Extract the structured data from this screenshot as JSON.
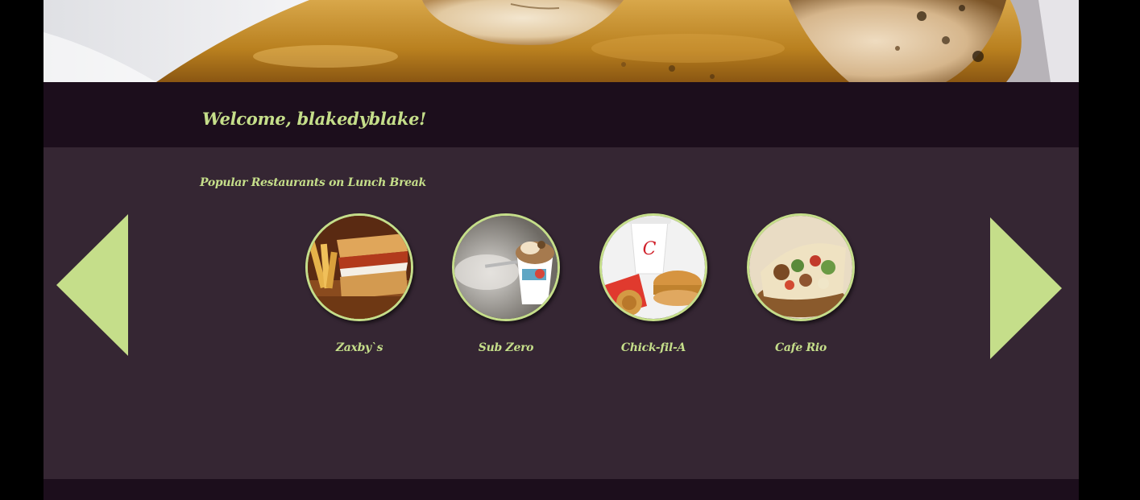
{
  "header": {
    "hero_image": "grilled-shrimp-in-butter-sauce"
  },
  "welcome": {
    "text": "Welcome, blakedyblake!"
  },
  "carousel": {
    "title": "Popular Restaurants on Lunch Break",
    "prev_icon": "triangle-left-icon",
    "next_icon": "triangle-right-icon",
    "restaurants": [
      {
        "name": "Zaxby`s",
        "image": "chicken-sandwich-with-fries"
      },
      {
        "name": "Sub Zero",
        "image": "ice-cream-cup-with-nitrogen-mist"
      },
      {
        "name": "Chick-fil-A",
        "image": "chicken-sandwich-waffle-fries-drink"
      },
      {
        "name": "Cafe Rio",
        "image": "tacos-with-pico"
      }
    ]
  },
  "colors": {
    "accent": "#c5de8a",
    "dark_band": "#1c0e1c",
    "content_bg": "#352633",
    "outer_bg": "#000000"
  }
}
